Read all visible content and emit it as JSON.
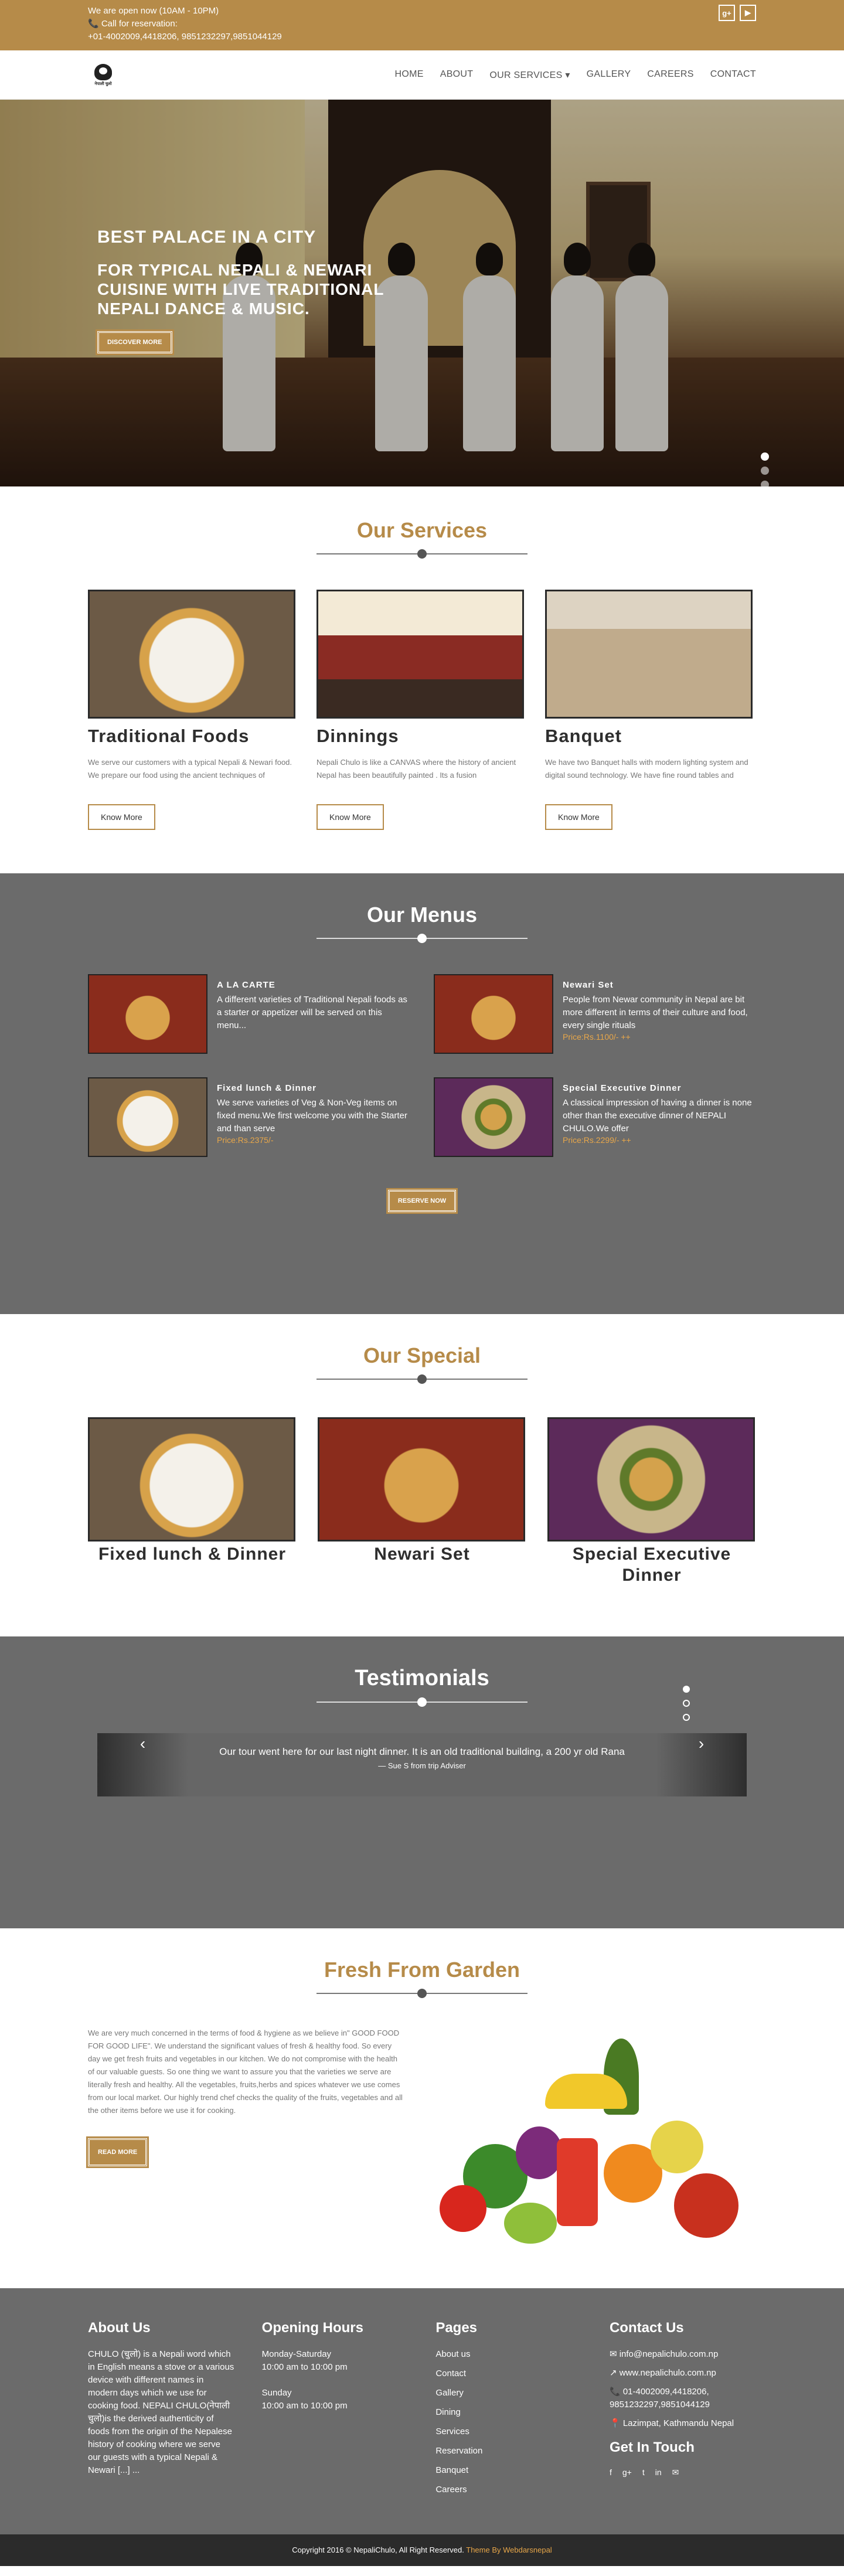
{
  "topbar": {
    "hours": "We are open now (10AM - 10PM)",
    "reservation_label": "📞 Call for reservation:",
    "phones": "+01-4002009,4418206, 9851232297,9851044129",
    "social_google": "g+",
    "social_youtube": "▶"
  },
  "logo": {
    "text": "नेपाली चुलो"
  },
  "nav": {
    "home": "HOME",
    "about": "ABOUT",
    "services": "OUR SERVICES ▾",
    "gallery": "GALLERY",
    "careers": "CAREERS",
    "contact": "CONTACT"
  },
  "hero": {
    "title": "BEST PALACE IN A CITY",
    "subtitle": "FOR TYPICAL NEPALI & NEWARI CUISINE WITH LIVE TRADITIONAL NEPALI DANCE & MUSIC.",
    "button": "DISCOVER MORE",
    "slides": 4,
    "active_slide": 1
  },
  "services": {
    "title": "Our Services",
    "items": [
      {
        "title": "Traditional Foods",
        "text": "We serve our customers with a typical Nepali & Newari food. We prepare our food using the ancient techniques of",
        "button": "Know More"
      },
      {
        "title": "Dinnings",
        "text": "Nepali Chulo is like a CANVAS where the history of ancient Nepal has been beautifully painted . Its a fusion",
        "button": "Know More"
      },
      {
        "title": "Banquet",
        "text": "We have two Banquet halls with modern lighting system and digital sound technology. We have fine round tables and",
        "button": "Know More"
      }
    ]
  },
  "menus": {
    "title": "Our Menus",
    "items": [
      {
        "title": "A LA CARTE",
        "text": "A different varieties of Traditional Nepali foods as a starter or appetizer will be served on this menu...",
        "price": ""
      },
      {
        "title": "Newari Set",
        "text": "People from Newar community in Nepal are bit more different in terms of their culture and food, every single rituals",
        "price": "Price:Rs.1100/- ++"
      },
      {
        "title": "Fixed lunch & Dinner",
        "text": "We serve varieties of Veg & Non-Veg items on fixed menu.We first welcome you with the Starter and than serve",
        "price": "Price:Rs.2375/-"
      },
      {
        "title": "Special Executive Dinner",
        "text": "A classical impression of having a dinner is none other than the executive dinner of NEPALI CHULO.We offer",
        "price": "Price:Rs.2299/- ++"
      }
    ],
    "button": "RESERVE NOW"
  },
  "special": {
    "title": "Our Special",
    "items": [
      {
        "title": "Fixed lunch & Dinner"
      },
      {
        "title": "Newari Set"
      },
      {
        "title": "Special Executive Dinner"
      }
    ]
  },
  "testimonials": {
    "title": "Testimonials",
    "quote": "Our tour went here for our last night dinner. It is an old traditional building, a 200 yr old Rana",
    "author": "— Sue S from trip Adviser",
    "prev": "‹",
    "next": "›",
    "dots": 3,
    "active_dot": 1
  },
  "garden": {
    "title": "Fresh From Garden",
    "text": "We are very much concerned in the terms of food & hygiene as we believe in\" GOOD FOOD FOR GOOD LIFE\". We understand the significant values of fresh & healthy food. So every day we get fresh fruits and vegetables in our kitchen. We do not compromise with the health of our valuable guests. So one thing we want to assure you that the varieties we serve are literally fresh and healthy. All the vegetables, fruits,herbs and spices whatever we use comes from our local market. Our highly trend chef checks the quality of the fruits, vegetables and all the other items before we use it for cooking.",
    "button": "READ MORE"
  },
  "footer": {
    "about_title": "About Us",
    "about_text": "CHULO (चुलो) is a Nepali word which in English means a stove or a various device with different names in modern days which we use for cooking food. NEPALI CHULO(नेपाली चुलो)is the derived authenticity of foods from the origin of the Nepalese history of cooking where we serve our guests with a typical Nepali & Newari [...] ...",
    "hours_title": "Opening Hours",
    "hours_days_1": "Monday-Saturday",
    "hours_time_1": "10:00 am to 10:00 pm",
    "hours_days_2": "Sunday",
    "hours_time_2": "10:00 am to 10:00 pm",
    "pages_title": "Pages",
    "pages": [
      "About us",
      "Contact",
      "Gallery",
      "Dining",
      "Services",
      "Reservation",
      "Banquet",
      "Careers"
    ],
    "contact_title": "Contact Us",
    "email": "✉ info@nepalichulo.com.np",
    "web": "↗ www.nepalichulo.com.np",
    "phone": "📞 01-4002009,4418206, 9851232297,9851044129",
    "address": "📍 Lazimpat, Kathmandu Nepal",
    "touch_title": "Get In Touch",
    "social": [
      "f",
      "g+",
      "t",
      "in",
      "✉"
    ]
  },
  "copyright": {
    "text": "Copyright 2016 © NepaliChulo, All Right Reserved.",
    "theme": "Theme By Webdarsnepal"
  }
}
